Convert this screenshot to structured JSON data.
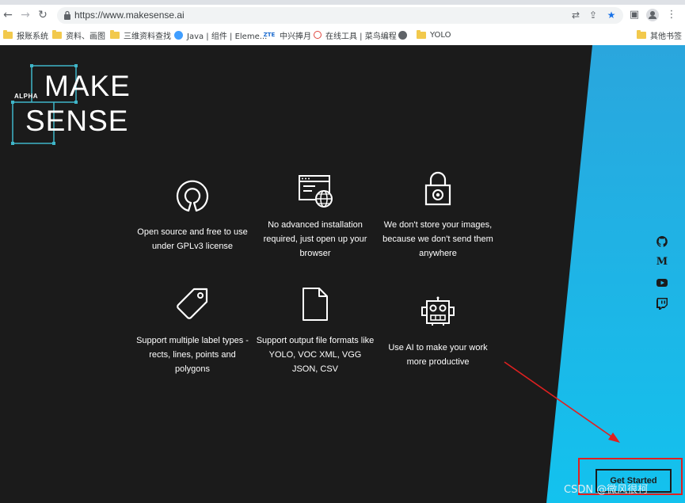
{
  "browser": {
    "url": "https://www.makesense.ai",
    "nav": {
      "back": "←",
      "forward": "→",
      "reload": "↻"
    },
    "bookmarks": [
      {
        "label": "报账系统",
        "icon": "folder-icon"
      },
      {
        "label": "资料、画图",
        "icon": "folder-icon"
      },
      {
        "label": "三维资料查找",
        "icon": "folder-icon"
      },
      {
        "label": "Java | 组件 | Eleme...",
        "icon": "element-favicon"
      },
      {
        "label": "中兴捧月",
        "icon": "zte-favicon",
        "icon_text": "ZTE"
      },
      {
        "label": "在线工具 | 菜鸟编程",
        "icon": "runoob-favicon"
      },
      {
        "label": "",
        "icon": "globe-icon"
      },
      {
        "label": "YOLO",
        "icon": "folder-icon"
      }
    ],
    "other_bookmarks": "其他书签"
  },
  "logo": {
    "alpha": "ALPHA",
    "make": "MAKE",
    "sense": "SENSE"
  },
  "features": [
    {
      "icon": "open-source-icon",
      "text": "Open source and free to use under GPLv3 license"
    },
    {
      "icon": "browser-globe-icon",
      "text": "No advanced installation required, just open up your browser"
    },
    {
      "icon": "padlock-icon",
      "text": "We don't store your images, because we don't send them anywhere"
    },
    {
      "icon": "tag-icon",
      "text": "Support multiple label types - rects, lines, points and polygons"
    },
    {
      "icon": "file-icon",
      "text": "Support output file formats like YOLO, VOC XML, VGG JSON, CSV"
    },
    {
      "icon": "robot-icon",
      "text": "Use AI to make your work more productive"
    }
  ],
  "socials": [
    {
      "icon": "github-icon"
    },
    {
      "icon": "medium-icon",
      "text": "M"
    },
    {
      "icon": "youtube-icon"
    },
    {
      "icon": "twitch-icon"
    }
  ],
  "cta": {
    "label": "Get Started"
  },
  "watermark": "CSDN @微风很柯",
  "colors": {
    "background": "#1b1b1b",
    "accent_blue": "#20b5e8",
    "highlight_red": "#e02020"
  }
}
